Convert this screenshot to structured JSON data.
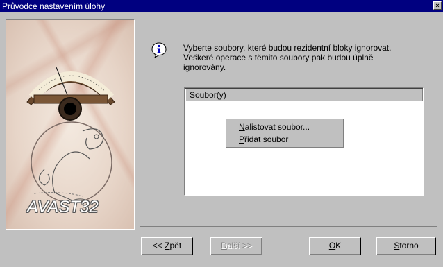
{
  "window": {
    "title": "Průvodce nastavením úlohy",
    "close_glyph": "×"
  },
  "banner": {
    "brand_text": "AVAST32"
  },
  "message": {
    "icon": "info-icon",
    "text": "Vyberte soubory, které budou rezidentní bloky ignorovat. Veškeré operace s těmito soubory pak budou úplně ignorovány."
  },
  "files_list": {
    "column_header": "Soubor(y)",
    "rows": []
  },
  "context_menu": {
    "items": [
      {
        "label": "Nalistovat soubor...",
        "access_key": "N",
        "rest": "alistovat soubor..."
      },
      {
        "label": "Přidat soubor",
        "access_key": "P",
        "rest": "řidat soubor"
      }
    ]
  },
  "buttons": {
    "back": {
      "label": "<< Zpět",
      "prefix": "<< ",
      "access_key": "Z",
      "rest": "pět",
      "enabled": true
    },
    "next": {
      "label": "Další >>",
      "access_key": "D",
      "rest": "alší >>",
      "enabled": false
    },
    "ok": {
      "label": "OK",
      "access_key": "O",
      "rest": "K",
      "enabled": true
    },
    "cancel": {
      "label": "Storno",
      "access_key": "S",
      "rest": "torno",
      "enabled": true
    }
  }
}
